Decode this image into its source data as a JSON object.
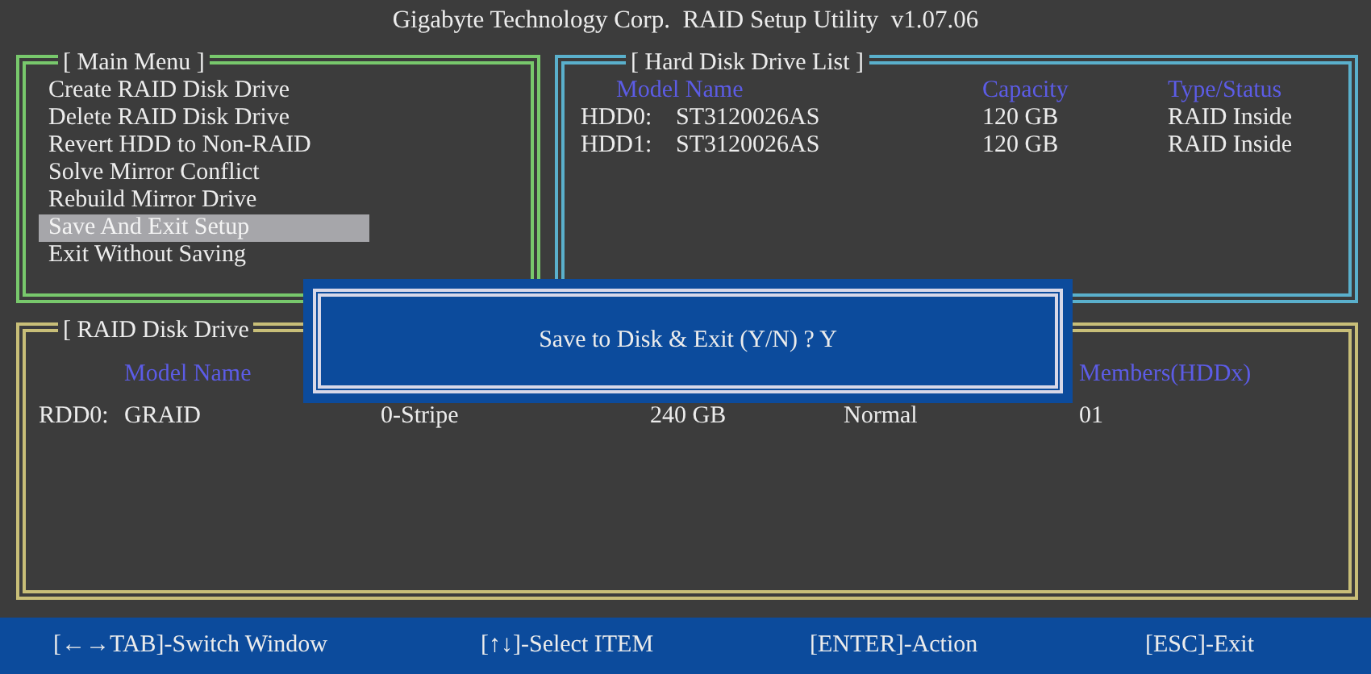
{
  "title": "Gigabyte Technology Corp.  RAID Setup Utility  v1.07.06",
  "main_menu": {
    "title": "[ Main Menu ]",
    "items": [
      {
        "label": "Create RAID Disk Drive",
        "selected": false
      },
      {
        "label": "Delete RAID Disk Drive",
        "selected": false
      },
      {
        "label": "Revert HDD to Non-RAID",
        "selected": false
      },
      {
        "label": "Solve Mirror Conflict",
        "selected": false
      },
      {
        "label": "Rebuild Mirror Drive",
        "selected": false
      },
      {
        "label": "Save And Exit Setup",
        "selected": true
      },
      {
        "label": "Exit Without Saving",
        "selected": false
      }
    ]
  },
  "hdd_list": {
    "title": "[ Hard Disk Drive List ]",
    "columns": [
      "Model Name",
      "Capacity",
      "Type/Status"
    ],
    "rows": [
      {
        "id": "HDD0:",
        "model": "ST3120026AS",
        "capacity": "120 GB",
        "status": "RAID Inside"
      },
      {
        "id": "HDD1:",
        "model": "ST3120026AS",
        "capacity": "120 GB",
        "status": "RAID Inside"
      }
    ]
  },
  "raid_list": {
    "title": "[ RAID Disk Drive",
    "model_header": "Model Name",
    "members_header": "Members(HDDx)",
    "rows": [
      {
        "id": "RDD0:",
        "model": "GRAID",
        "raid_type": "0-Stripe",
        "capacity": "240 GB",
        "status": "Normal",
        "members": "01"
      }
    ]
  },
  "dialog": {
    "message": "Save to Disk & Exit (Y/N) ? Y"
  },
  "footer": [
    "[←→TAB]-Switch Window",
    "[↑↓]-Select ITEM",
    "[ENTER]-Action",
    "[ESC]-Exit"
  ]
}
